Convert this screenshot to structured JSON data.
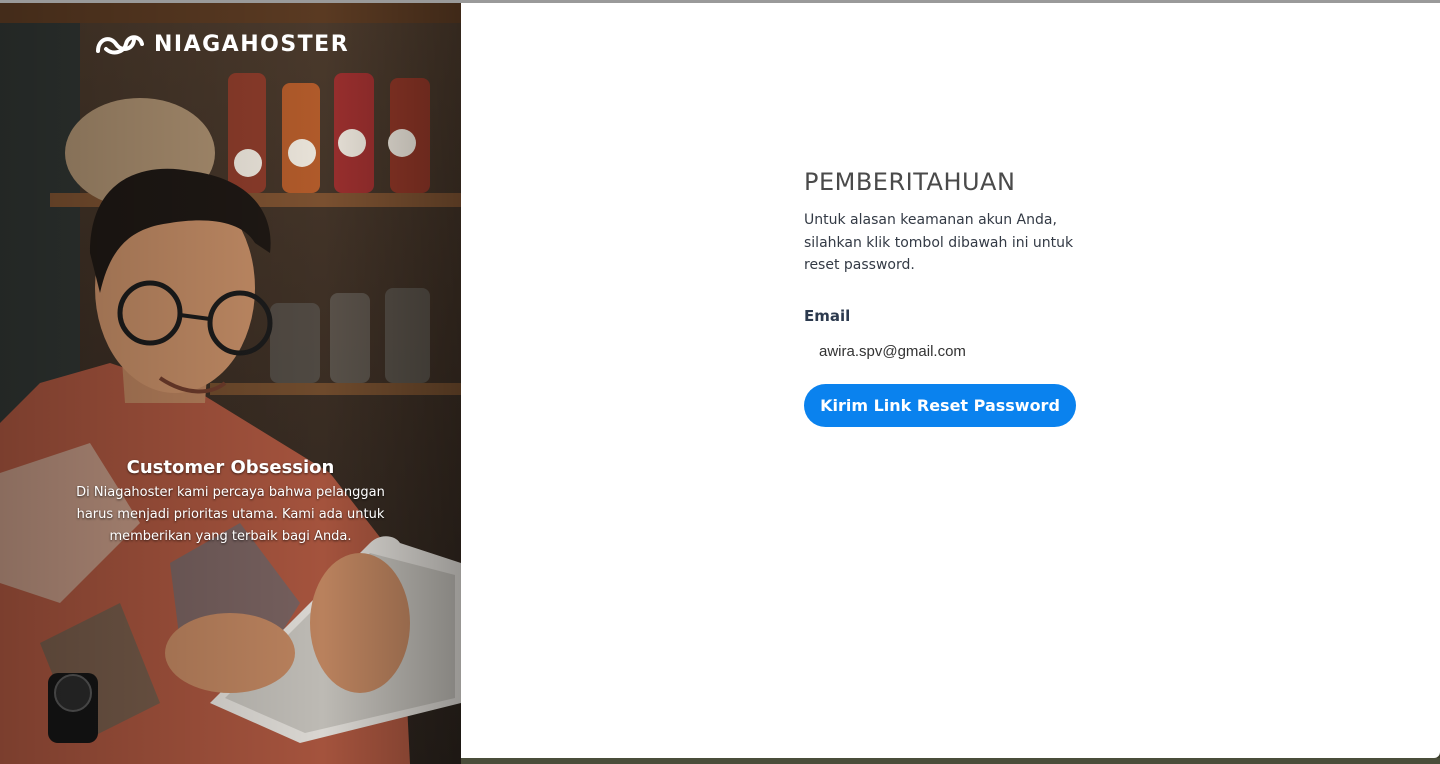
{
  "brand": {
    "name": "NIAGAHOSTER",
    "logo_icon": "niagahoster-wave-logo"
  },
  "promo": {
    "title": "Customer Obsession",
    "text": "Di Niagahoster kami percaya bahwa pelanggan harus menjadi prioritas utama. Kami ada untuk memberikan yang terbaik bagi Anda."
  },
  "notice": {
    "title": "PEMBERITAHUAN",
    "description": "Untuk alasan keamanan akun Anda, silahkan klik tombol dibawah ini untuk reset password."
  },
  "form": {
    "email_label": "Email",
    "email_value": "awira.spv@gmail.com",
    "submit_label": "Kirim Link Reset Password"
  },
  "colors": {
    "accent": "#0a82ee",
    "title_text": "#4a4a4a",
    "label_text": "#2c3a4e"
  }
}
